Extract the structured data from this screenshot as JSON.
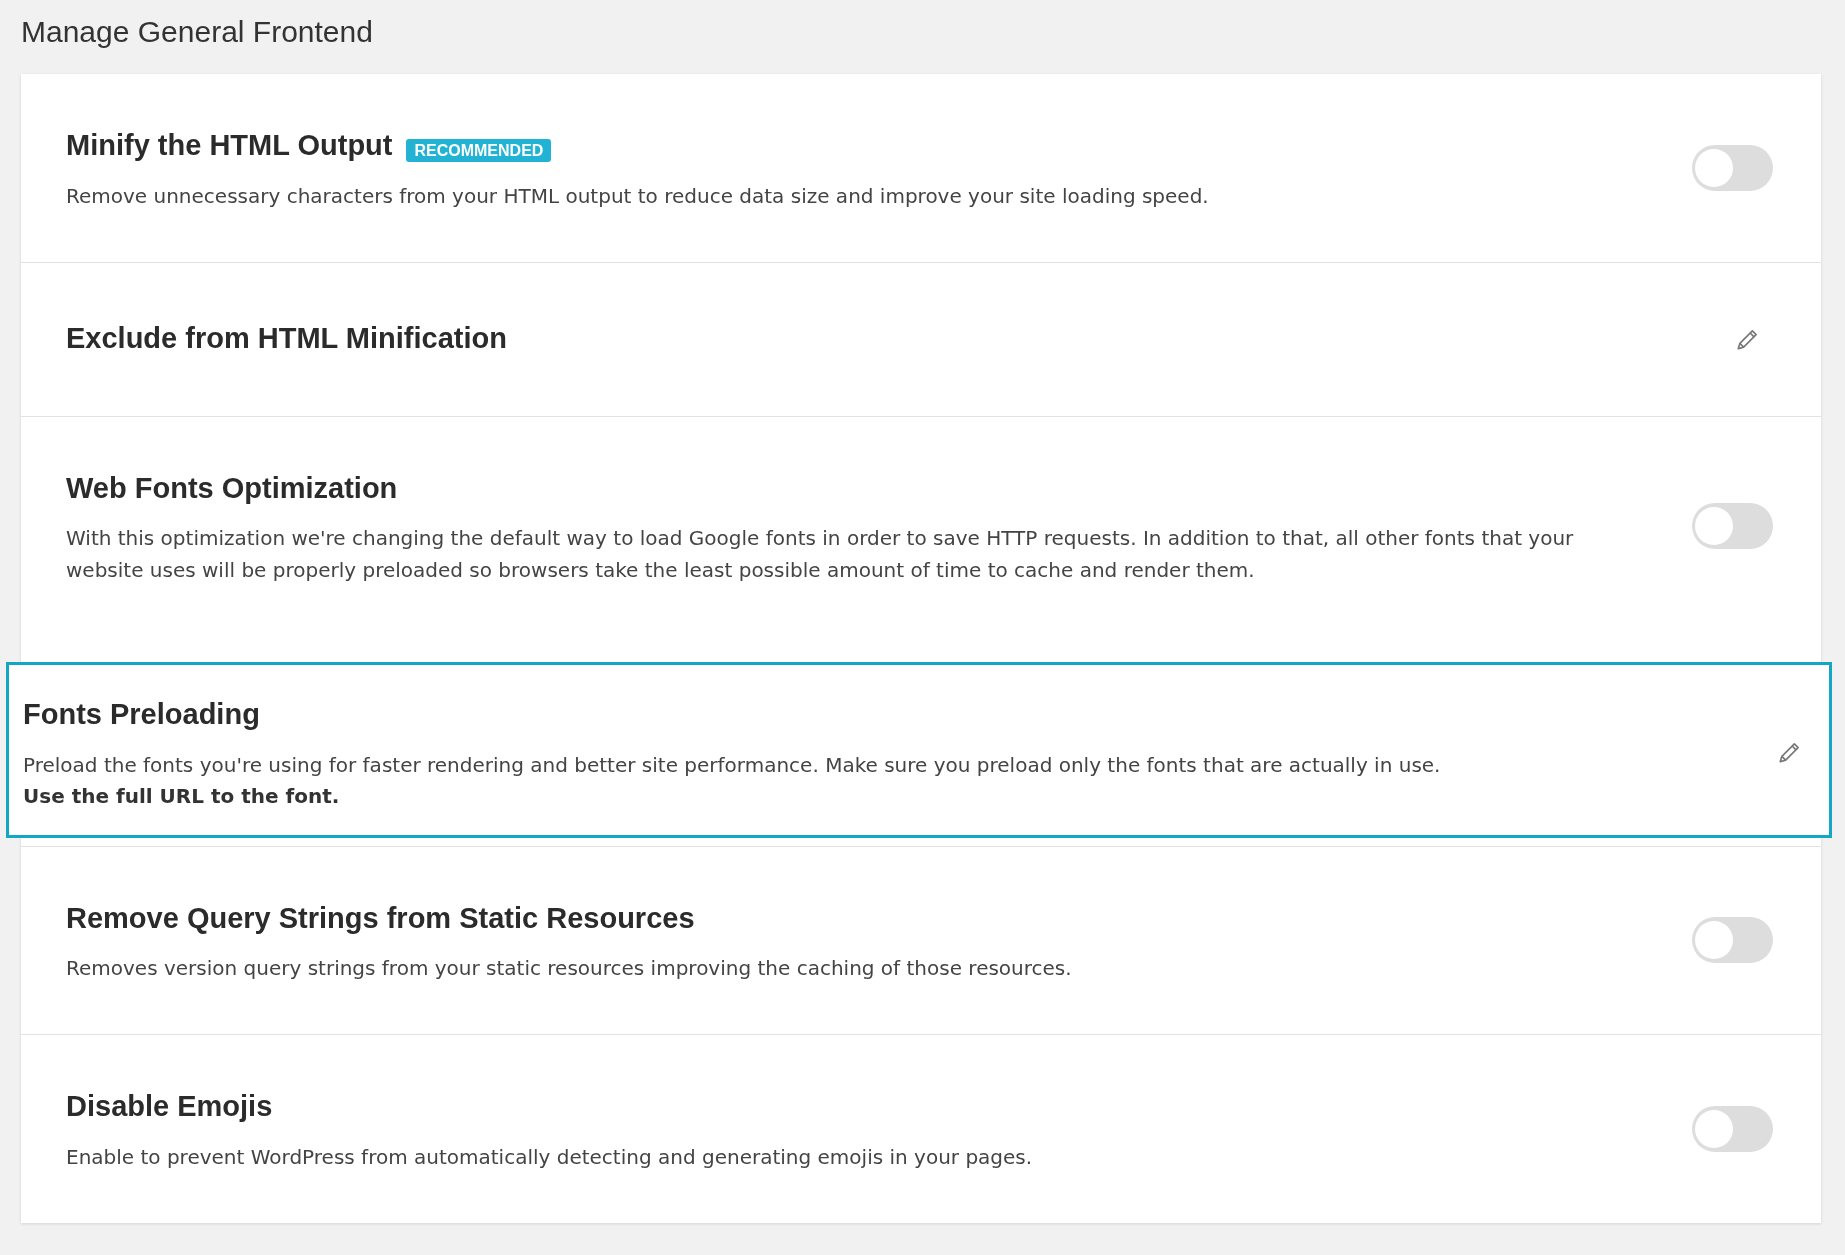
{
  "page_title": "Manage General Frontend",
  "settings": [
    {
      "kind": "toggle",
      "title": "Minify the HTML Output",
      "badge": "RECOMMENDED",
      "description": "Remove unnecessary characters from your HTML output to reduce data size and improve your site loading speed.",
      "on": false,
      "highlighted": false
    },
    {
      "kind": "edit",
      "title": "Exclude from HTML Minification",
      "highlighted": false
    },
    {
      "kind": "toggle",
      "title": "Web Fonts Optimization",
      "description": "With this optimization we're changing the default way to load Google fonts in order to save HTTP requests. In addition to that, all other fonts that your website uses will be properly preloaded so browsers take the least possible amount of time to cache and render them.",
      "on": false,
      "highlighted": false
    },
    {
      "kind": "edit",
      "title": "Fonts Preloading",
      "description": "Preload the fonts you're using for faster rendering and better site performance. Make sure you preload only the fonts that are actually in use.",
      "note": "Use the full URL to the font.",
      "highlighted": true
    },
    {
      "kind": "toggle",
      "title": "Remove Query Strings from Static Resources",
      "description": "Removes version query strings from your static resources improving the caching of those resources.",
      "on": false,
      "highlighted": false
    },
    {
      "kind": "toggle",
      "title": "Disable Emojis",
      "description": "Enable to prevent WordPress from automatically detecting and generating emojis in your pages.",
      "on": false,
      "highlighted": false
    }
  ]
}
